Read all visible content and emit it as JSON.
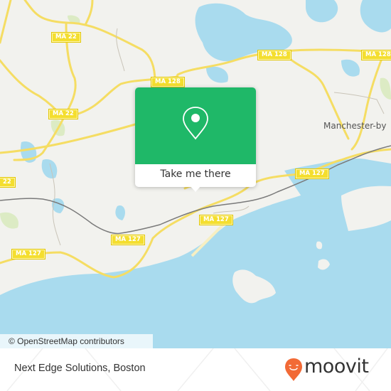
{
  "map": {
    "colors": {
      "land": "#f2f2ee",
      "water": "#a9dbee",
      "road": "#f5dd63",
      "road_edge": "#e9c94a",
      "park": "#dcebc4",
      "rail": "#7a7a7a",
      "accent": "#1fb868"
    },
    "road_shields": [
      {
        "id": "ma22-north",
        "label": "MA 22"
      },
      {
        "id": "ma22-center",
        "label": "MA 22"
      },
      {
        "id": "ma22-west",
        "label": "22"
      },
      {
        "id": "ma128-west",
        "label": "MA 128"
      },
      {
        "id": "ma128-center",
        "label": "MA 128"
      },
      {
        "id": "ma128-east",
        "label": "MA 128"
      },
      {
        "id": "ma127-west",
        "label": "MA 127"
      },
      {
        "id": "ma127-center",
        "label": "MA 127"
      },
      {
        "id": "ma127-mid",
        "label": "MA 127"
      },
      {
        "id": "ma127-east",
        "label": "MA 127"
      }
    ],
    "place_labels": [
      {
        "id": "manchester",
        "label": "Manchester-by"
      }
    ],
    "attribution": "© OpenStreetMap contributors"
  },
  "popup": {
    "icon": "location-pin-icon",
    "button_label": "Take me there"
  },
  "footer": {
    "title": "Next Edge Solutions, Boston",
    "brand": "moovit",
    "brand_color": "#f26a36"
  }
}
